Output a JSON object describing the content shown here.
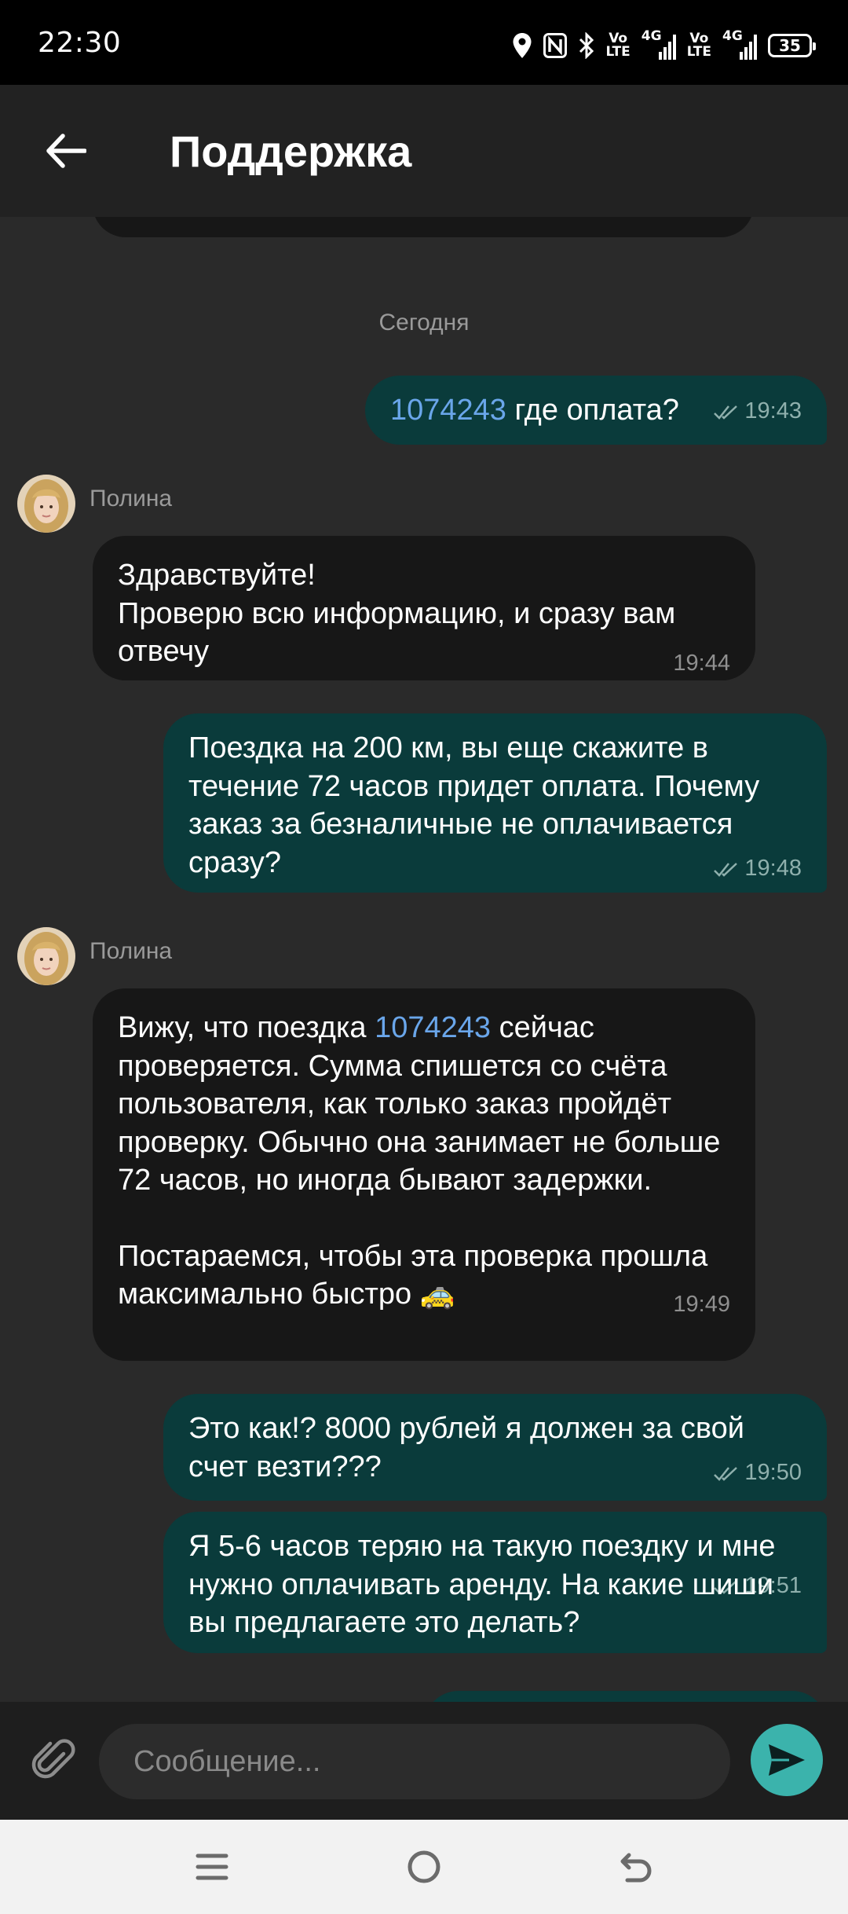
{
  "status_bar": {
    "time": "22:30",
    "icons": [
      "location-icon",
      "nfc-icon",
      "bluetooth-icon",
      "volte-icon",
      "signal-4g-icon",
      "volte-icon",
      "signal-4g-icon"
    ],
    "volte_top": "Vo",
    "volte_bottom": "LTE",
    "net": "4G",
    "battery": "35"
  },
  "header": {
    "title": "Поддержка",
    "back_icon": "arrow-left-icon"
  },
  "chat": {
    "date_separator": "Сегодня",
    "messages": [
      {
        "direction": "out",
        "link": "1074243",
        "text": " где оплата?",
        "time": "19:43"
      },
      {
        "direction": "in",
        "sender": "Полина",
        "lines": [
          "Здравствуйте!",
          "Проверю всю информацию, и сразу вам отвечу"
        ],
        "time": "19:44"
      },
      {
        "direction": "out",
        "text": "Поездка на 200 км, вы еще скажите в течение 72 часов придет оплата. Почему заказ за безналичные не оплачивается сразу?",
        "time": "19:48"
      },
      {
        "direction": "in",
        "sender": "Полина",
        "text_before_link": "Вижу, что поездка ",
        "link": "1074243",
        "text_after_link": " сейчас проверяется. Сумма спишется со счёта пользователя, как только заказ пройдёт проверку. Обычно она занимает не больше 72 часов, но иногда бывают задержки.",
        "text_para2": "Постараемся, чтобы эта проверка прошла максимально быстро ",
        "emoji": "🚕",
        "time": "19:49"
      },
      {
        "direction": "out",
        "text": "Это как!? 8000 рублей я должен за свой счет везти???",
        "time": "19:50"
      },
      {
        "direction": "out",
        "text": "Я 5-6 часов теряю на такую поездку и мне нужно оплачивать аренду. На какие шиши вы предлагаете это делать?",
        "time": "19:51"
      }
    ]
  },
  "input": {
    "placeholder": "Сообщение...",
    "value": "",
    "attach_icon": "paperclip-icon",
    "send_icon": "send-icon"
  },
  "nav": {
    "icons": [
      "menu-icon",
      "home-icon",
      "back-icon"
    ]
  },
  "colors": {
    "background": "#2a2a2a",
    "header": "#222222",
    "incoming_bubble": "#171717",
    "outgoing_bubble": "#0a3b3b",
    "link": "#6aa6ea",
    "send_button": "#3bb3ac"
  }
}
